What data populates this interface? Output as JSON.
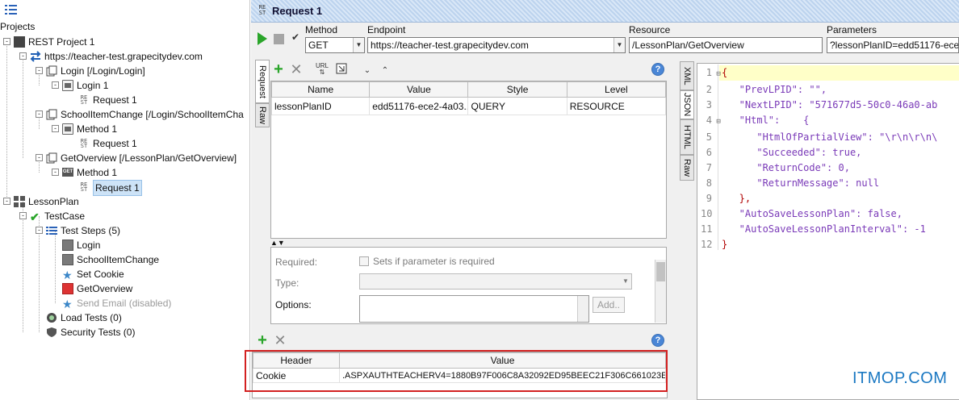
{
  "left": {
    "header": "Projects",
    "tree": [
      {
        "label": "REST Project 1",
        "icon": "folder-icon"
      },
      {
        "label": "https://teacher-test.grapecitydev.com",
        "icon": "swap-arrows-icon"
      },
      {
        "label": "Login [/Login/Login]",
        "icon": "resource-icon"
      },
      {
        "label": "Login 1",
        "icon": "method-icon"
      },
      {
        "label": "Request 1",
        "icon": "request-icon"
      },
      {
        "label": "SchoolItemChange [/Login/SchoolItemCha",
        "icon": "resource-icon"
      },
      {
        "label": "Method 1",
        "icon": "method-icon"
      },
      {
        "label": "Request 1",
        "icon": "request-icon"
      },
      {
        "label": "GetOverview [/LessonPlan/GetOverview]",
        "icon": "resource-icon"
      },
      {
        "label": "Method 1",
        "icon": "method-get-icon",
        "badge": "GET"
      },
      {
        "label": "Request 1",
        "icon": "request-icon"
      },
      {
        "label": "LessonPlan",
        "icon": "grid-icon"
      },
      {
        "label": "TestCase",
        "icon": "check-icon"
      },
      {
        "label": "Test Steps (5)",
        "icon": "list-icon"
      },
      {
        "label": "Login",
        "icon": "step-icon"
      },
      {
        "label": "SchoolItemChange",
        "icon": "step-icon"
      },
      {
        "label": "Set Cookie",
        "icon": "star-icon"
      },
      {
        "label": "GetOverview",
        "icon": "rest-step-icon"
      },
      {
        "label": "Send Email (disabled)",
        "icon": "star-icon"
      },
      {
        "label": "Load Tests (0)",
        "icon": "gauge-icon"
      },
      {
        "label": "Security Tests (0)",
        "icon": "shield-icon"
      }
    ]
  },
  "request": {
    "title": "Request 1",
    "badge_top": "RE",
    "badge_bottom": "ST",
    "method_label": "Method",
    "method_value": "GET",
    "endpoint_label": "Endpoint",
    "endpoint_value": "https://teacher-test.grapecitydev.com",
    "resource_label": "Resource",
    "resource_value": "/LessonPlan/GetOverview",
    "parameters_label": "Parameters",
    "parameters_value": "?lessonPlanID=edd51176-ece2-"
  },
  "left_tabs": [
    "Request",
    "Raw"
  ],
  "right_tabs": [
    "XML",
    "JSON",
    "HTML",
    "Raw"
  ],
  "params_table": {
    "columns": [
      "Name",
      "Value",
      "Style",
      "Level"
    ],
    "rows": [
      [
        "lessonPlanID",
        "edd51176-ece2-4a03...",
        "QUERY",
        "RESOURCE"
      ]
    ]
  },
  "param_props": {
    "required_label": "Required:",
    "required_check_text": "Sets if parameter is required",
    "type_label": "Type:",
    "options_label": "Options:",
    "add_button": "Add.."
  },
  "headers_table": {
    "columns": [
      "Header",
      "Value"
    ],
    "rows": [
      [
        "Cookie",
        ".ASPXAUTHTEACHERV4=1880B97F006C8A32092ED95BEEC21F306C661023E..."
      ]
    ]
  },
  "json_lines": [
    {
      "n": "1",
      "text": "{"
    },
    {
      "n": "2",
      "text": "   \"PrevLPID\": \"\","
    },
    {
      "n": "3",
      "text": "   \"NextLPID\": \"571677d5-50c0-46a0-ab"
    },
    {
      "n": "4",
      "text": "   \"Html\":    {"
    },
    {
      "n": "5",
      "text": "      \"HtmlOfPartialView\": \"\\r\\n\\r\\n\\"
    },
    {
      "n": "6",
      "text": "      \"Succeeded\": true,"
    },
    {
      "n": "7",
      "text": "      \"ReturnCode\": 0,"
    },
    {
      "n": "8",
      "text": "      \"ReturnMessage\": null"
    },
    {
      "n": "9",
      "text": "   },"
    },
    {
      "n": "10",
      "text": "   \"AutoSaveLessonPlan\": false,"
    },
    {
      "n": "11",
      "text": "   \"AutoSaveLessonPlanInterval\": -1"
    },
    {
      "n": "12",
      "text": "}"
    }
  ],
  "watermark": "ITMOP.COM"
}
